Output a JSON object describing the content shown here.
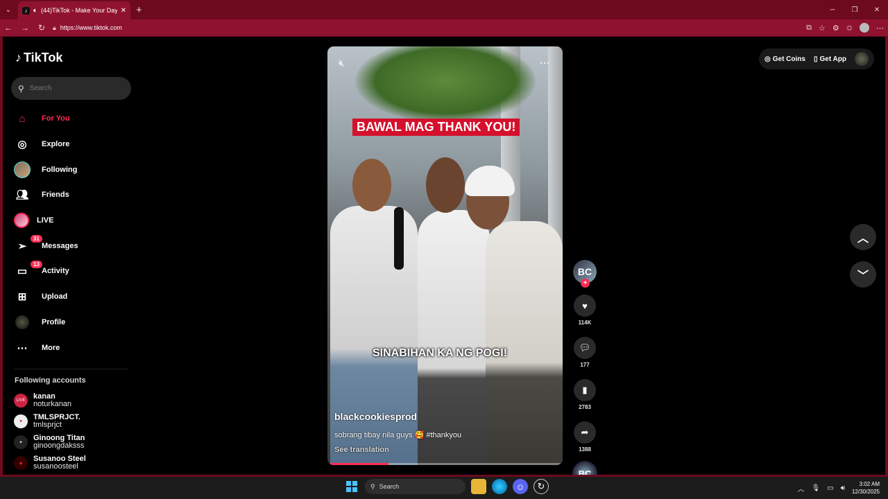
{
  "browser": {
    "tab_title": "(44)TikTok - Make Your Day",
    "url": "https://www.tiktok.com",
    "tab_close": "✕",
    "new_tab": "+"
  },
  "sidebar": {
    "logo_text": "TikTok",
    "search_placeholder": "Search",
    "nav": [
      {
        "label": "For You",
        "icon": "home-icon"
      },
      {
        "label": "Explore",
        "icon": "compass-icon"
      },
      {
        "label": "Following",
        "icon": "following-avatar"
      },
      {
        "label": "Friends",
        "icon": "friends-icon"
      },
      {
        "label": "LIVE",
        "icon": "live-avatar"
      },
      {
        "label": "Messages",
        "icon": "messages-icon",
        "badge": "31"
      },
      {
        "label": "Activity",
        "icon": "activity-icon",
        "badge": "13"
      },
      {
        "label": "Upload",
        "icon": "upload-icon"
      },
      {
        "label": "Profile",
        "icon": "profile-avatar"
      },
      {
        "label": "More",
        "icon": "more-icon"
      }
    ],
    "following_header": "Following accounts",
    "following_accounts": [
      {
        "name": "kanan",
        "handle": "noturkanan"
      },
      {
        "name": "TMLSPRJCT.",
        "handle": "tmlsprjct"
      },
      {
        "name": "Ginoong Titan",
        "handle": "ginoongdaksss"
      },
      {
        "name": "Susanoo Steel",
        "handle": "susanoosteel"
      }
    ]
  },
  "topbar": {
    "get_coins": "Get Coins",
    "get_app": "Get App"
  },
  "video": {
    "caption_top": "BAWAL MAG THANK YOU!",
    "caption_bottom": "SINABIHAN KA NG POGI!",
    "author": "blackcookiesprod",
    "description": "sobrang tibay nila guys 🥰 #thankyou",
    "see_translation": "See translation",
    "progress": 0.26
  },
  "actions": {
    "author_avatar": "BC",
    "likes": "114K",
    "comments": "177",
    "saves": "2783",
    "shares": "1388"
  },
  "taskbar": {
    "search_label": "Search",
    "time": "3:02 AM",
    "date": "12/30/2025"
  },
  "colors": {
    "accent": "#fe2c55",
    "browser_frame": "#6e0a1e"
  }
}
